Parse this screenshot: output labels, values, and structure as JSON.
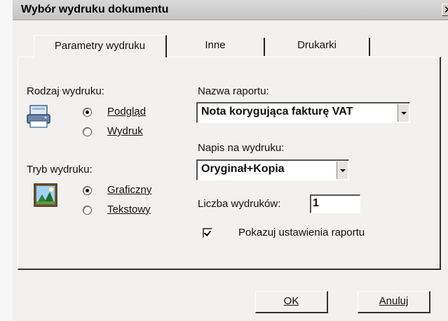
{
  "window": {
    "title": "Wybór wydruku dokumentu",
    "close_glyph": "✕"
  },
  "tabs": [
    {
      "label": "Parametry wydruku",
      "active": true
    },
    {
      "label": "Inne",
      "active": false
    },
    {
      "label": "Drukarki",
      "active": false
    }
  ],
  "print_type": {
    "label": "Rodzaj wydruku:",
    "icon": "printer-icon",
    "options": [
      {
        "label": "Podgląd",
        "checked": true
      },
      {
        "label": "Wydruk",
        "checked": false
      }
    ]
  },
  "print_mode": {
    "label": "Tryb wydruku:",
    "icon": "picture-icon",
    "options": [
      {
        "label": "Graficzny",
        "checked": true
      },
      {
        "label": "Tekstowy",
        "checked": false
      }
    ]
  },
  "report_name": {
    "label": "Nazwa raportu:",
    "value": "Nota korygująca fakturę VAT"
  },
  "print_caption": {
    "label": "Napis na wydruku:",
    "value": "Oryginał+Kopia"
  },
  "copies": {
    "label": "Liczba wydruków:",
    "value": "1"
  },
  "show_settings": {
    "label": "Pokazuj ustawienia raportu",
    "checked": true
  },
  "buttons": {
    "ok": "OK",
    "cancel": "Anuluj"
  }
}
